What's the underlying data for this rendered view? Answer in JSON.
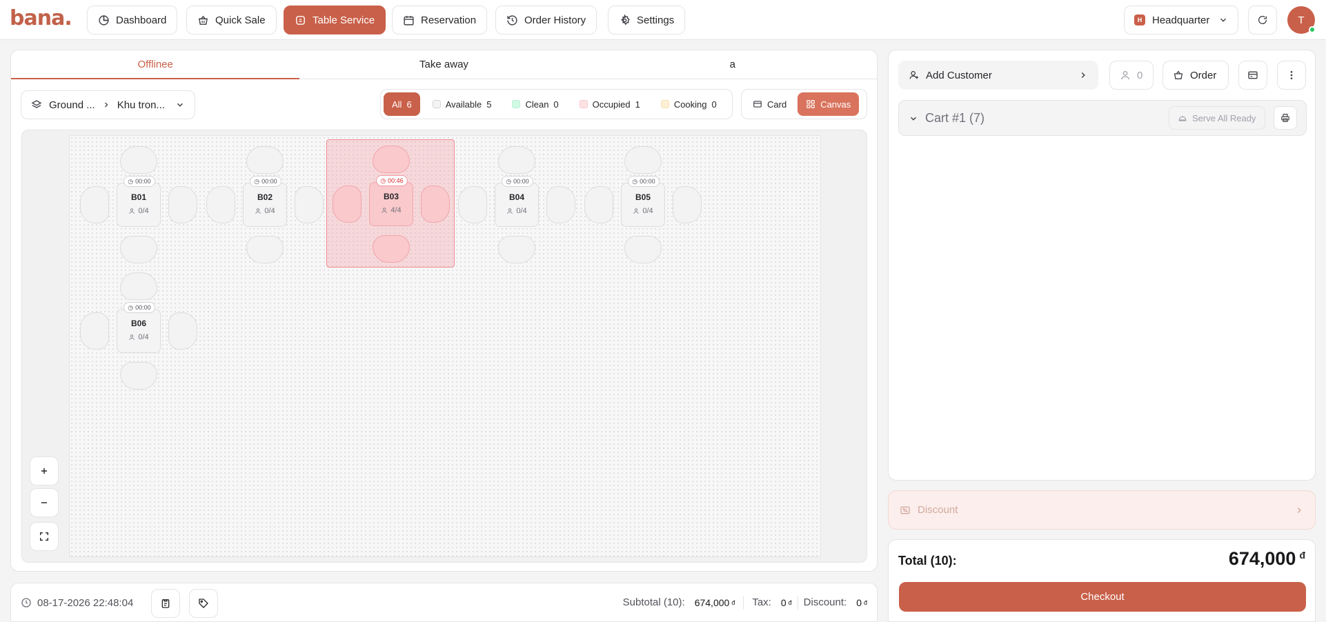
{
  "brand": {
    "logo": "bana."
  },
  "nav": {
    "dashboard": "Dashboard",
    "quick_sale": "Quick Sale",
    "table_service": "Table Service",
    "reservation": "Reservation",
    "order_history": "Order History",
    "settings": "Settings"
  },
  "location": {
    "badge": "H",
    "name": "Headquarter"
  },
  "user": {
    "initial": "T"
  },
  "order_tabs": [
    "Offlinee",
    "Take away",
    "a"
  ],
  "floor": {
    "floor_name": "Ground ...",
    "area_name": "Khu tron..."
  },
  "filters": [
    {
      "label": "All",
      "count": "6",
      "color": "#c96049"
    },
    {
      "label": "Available",
      "count": "5",
      "color": "#f4f4f5"
    },
    {
      "label": "Clean",
      "count": "0",
      "color": "#d1fae5"
    },
    {
      "label": "Occupied",
      "count": "1",
      "color": "#fde2e4"
    },
    {
      "label": "Cooking",
      "count": "0",
      "color": "#fdf0d5"
    }
  ],
  "view": {
    "card": "Card",
    "canvas": "Canvas"
  },
  "tables": [
    {
      "name": "B01",
      "timer": "00:00",
      "seats": "0/4",
      "status": "available"
    },
    {
      "name": "B02",
      "timer": "00:00",
      "seats": "0/4",
      "status": "available"
    },
    {
      "name": "B03",
      "timer": "00:46",
      "seats": "4/4",
      "status": "occupied"
    },
    {
      "name": "B04",
      "timer": "00:00",
      "seats": "0/4",
      "status": "available"
    },
    {
      "name": "B05",
      "timer": "00:00",
      "seats": "0/4",
      "status": "available"
    },
    {
      "name": "B06",
      "timer": "00:00",
      "seats": "0/4",
      "status": "available"
    }
  ],
  "footer": {
    "datetime": "08-17-2026 22:48:04",
    "subtotal_label": "Subtotal (10):",
    "subtotal_value": "674,000",
    "tax_label": "Tax:",
    "tax_value": "0",
    "discount_label": "Discount:",
    "discount_value": "0",
    "currency": "đ"
  },
  "order_panel": {
    "add_customer": "Add Customer",
    "guest_count": "0",
    "order_label": "Order",
    "cart_title": "Cart #1 (7)",
    "serve_all": "Serve All Ready",
    "discount_label": "Discount",
    "total_label": "Total (10):",
    "total_value": "674,000",
    "currency": "đ",
    "checkout_label": "Checkout"
  },
  "colors": {
    "accent": "#c96049",
    "occupied": "#f9c9cc",
    "success": "#22c55e"
  }
}
